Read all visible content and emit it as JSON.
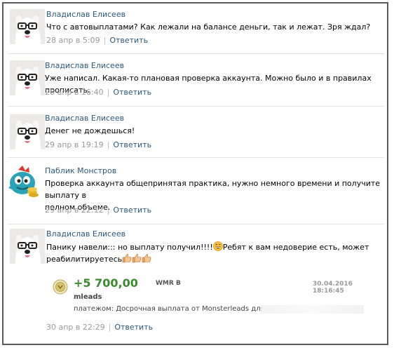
{
  "comments": [
    {
      "author": "Владислав Елисеев",
      "text": "Что с автовыплатами? Как лежали на балансе деньги, так и лежат. Зря ждал?",
      "time": "28 апр в 5:09",
      "reply": "Ответить"
    },
    {
      "author": "Владислав Елисеев",
      "text": "Уже написал. Какая-то плановая проверка аккаунта. Можно было и в правилах прописать.",
      "time": "28 апр в 16:40",
      "reply": "Ответить"
    },
    {
      "author": "Владислав Елисеев",
      "text": "Денег не дождешься!",
      "time": "29 апр в 19:19",
      "reply": "Ответить"
    },
    {
      "author": "Паблик Монстров",
      "text_line1": "Проверка аккаунта общепринятая практика, нужно немного времени и получите выплату в",
      "text_line2": "полном объеме.",
      "time": "29 апр в 22:12",
      "reply": "Ответить"
    },
    {
      "author": "Владислав Елисеев",
      "text_part1": "Панику навели::: но выплату получил!!!!",
      "text_part2": "Ребят к вам недоверие есть, может",
      "text_line2": "реабилитируетесь",
      "time": "30 апр в 22:29",
      "reply": "Ответить"
    }
  ],
  "attachment": {
    "amount": "+5 700,00",
    "currency": "WMR B",
    "date": "30.04.2016 18:16:45",
    "sender": "mleads",
    "purpose": "платежом: Досрочная выплата от Monsterleads для"
  },
  "colors": {
    "link": "#2b587a",
    "amount": "#3c8a2e",
    "meta": "#999999"
  },
  "icons": [
    "dog-avatar",
    "monster-avatar",
    "laughing-emoji-icon",
    "thumbs-up-icon",
    "webmoney-coin-icon"
  ]
}
